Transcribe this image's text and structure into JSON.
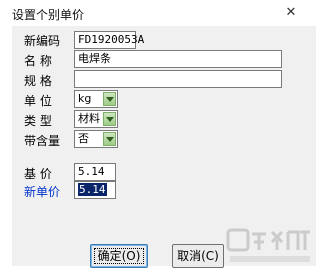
{
  "window": {
    "title": "设置个别单价"
  },
  "form": {
    "code_label": "新编码",
    "code_value": "FD1920053A",
    "name_label": "名    称",
    "name_value": "电焊条",
    "spec_label": "规    格",
    "spec_value": "",
    "unit_label": "单    位",
    "unit_value": "kg",
    "type_label": "类    型",
    "type_value": "材料",
    "content_label": "带含量",
    "content_value": "否",
    "base_price_label": "基    价",
    "base_price_value": "5.14",
    "new_price_label": "新单价",
    "new_price_value": "5.14"
  },
  "buttons": {
    "ok_label": "确定(O)",
    "cancel_label": "取消(C)"
  },
  "colors": {
    "accent_label": "#0033cc",
    "combo_arrow": "#9fcc88",
    "selection": "#0a246a"
  }
}
